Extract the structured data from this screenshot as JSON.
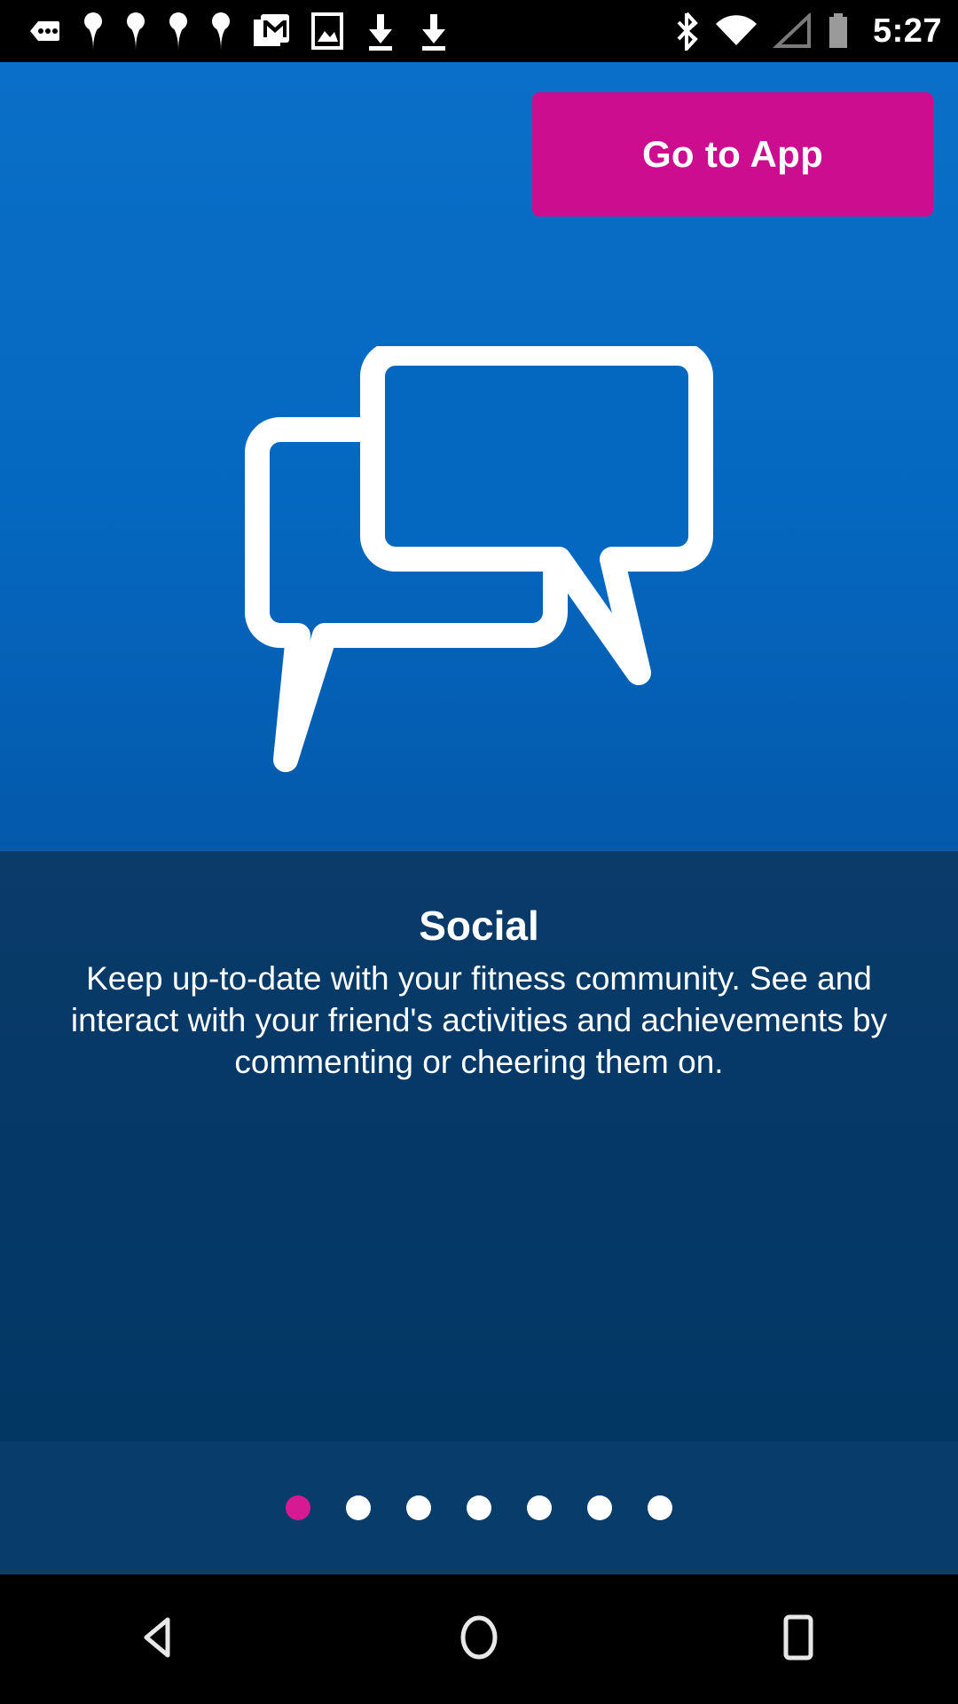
{
  "status_bar": {
    "time": "5:27",
    "left_icons": [
      {
        "name": "message-dots-icon",
        "label": "messages"
      },
      {
        "name": "notification-pin-icon-1",
        "label": "notification"
      },
      {
        "name": "notification-pin-icon-2",
        "label": "notification"
      },
      {
        "name": "notification-pin-icon-3",
        "label": "notification"
      },
      {
        "name": "notification-pin-icon-4",
        "label": "notification"
      },
      {
        "name": "gmail-icon",
        "label": "Gmail"
      },
      {
        "name": "image-icon",
        "label": "screenshot"
      },
      {
        "name": "download-icon-1",
        "label": "download"
      },
      {
        "name": "download-icon-2",
        "label": "download"
      }
    ],
    "right_icons": [
      {
        "name": "bluetooth-icon",
        "label": "Bluetooth"
      },
      {
        "name": "wifi-icon",
        "label": "Wi-Fi"
      },
      {
        "name": "cellular-signal-icon",
        "label": "Signal"
      },
      {
        "name": "battery-icon",
        "label": "Battery"
      }
    ]
  },
  "hero": {
    "go_to_app_label": "Go to App",
    "illustration_name": "two-speech-bubbles-icon",
    "background_color": "#0568c0",
    "button_color": "#cc0d90"
  },
  "info": {
    "title": "Social",
    "description": "Keep up-to-date with your fitness community. See and interact with your friend's activities and achievements by commenting or cheering them on.",
    "background_color": "#073968"
  },
  "pager": {
    "total": 7,
    "active_index": 0,
    "active_color": "#d61a94",
    "inactive_color": "#ffffff",
    "dots": [
      {
        "label": "page-1",
        "active": true
      },
      {
        "label": "page-2",
        "active": false
      },
      {
        "label": "page-3",
        "active": false
      },
      {
        "label": "page-4",
        "active": false
      },
      {
        "label": "page-5",
        "active": false
      },
      {
        "label": "page-6",
        "active": false
      },
      {
        "label": "page-7",
        "active": false
      }
    ]
  },
  "nav_bar": {
    "back_label": "Back",
    "home_label": "Home",
    "recents_label": "Recents"
  }
}
